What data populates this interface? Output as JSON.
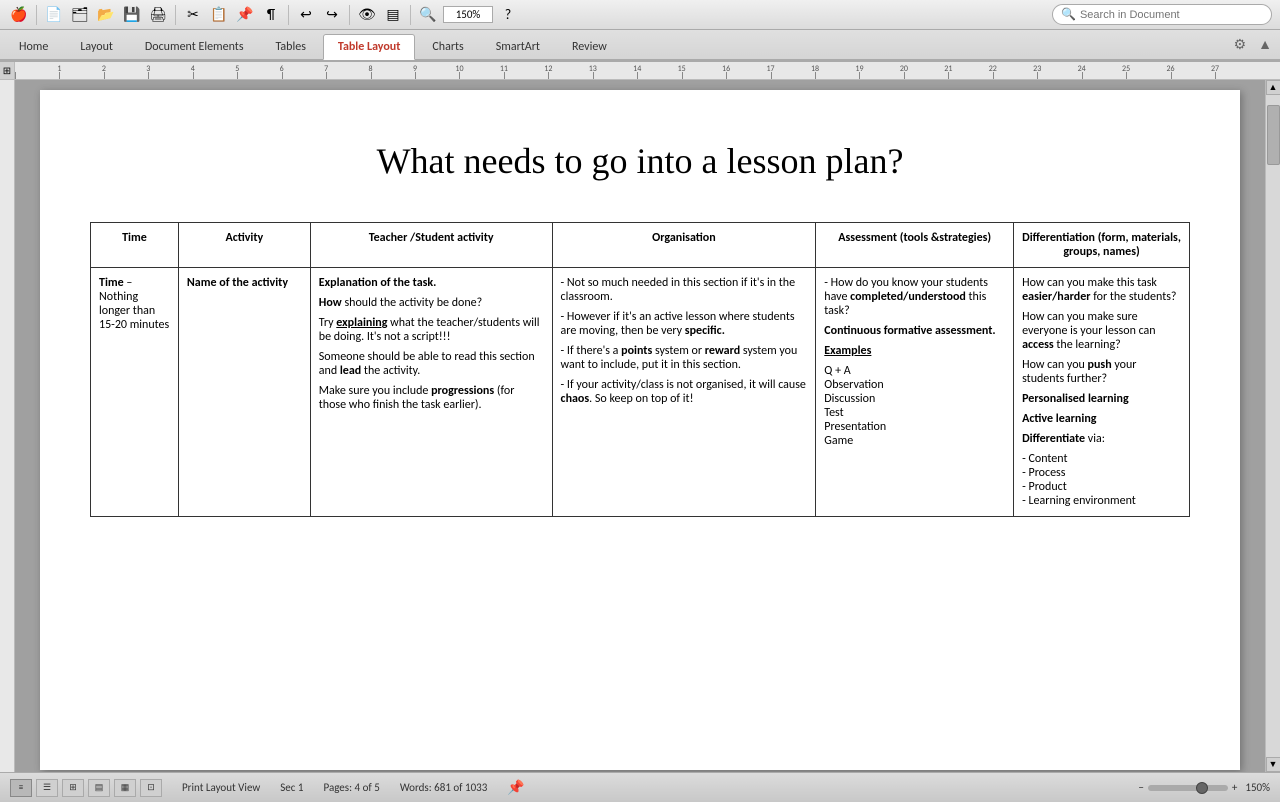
{
  "titlebar": {
    "search_placeholder": "Search in Document",
    "zoom_value": "150%"
  },
  "tabs": {
    "items": [
      "Home",
      "Layout",
      "Document Elements",
      "Tables",
      "Table Layout",
      "Charts",
      "SmartArt",
      "Review"
    ],
    "active": "Table Layout"
  },
  "document": {
    "title": "What needs to go into a lesson plan?",
    "table": {
      "headers": [
        "Time",
        "Activity",
        "Teacher /Student activity",
        "Organisation",
        "Assessment (tools &strategies)",
        "Differentiation (form, materials, groups, names)"
      ],
      "row": {
        "time": "Time – Nothing longer than 15-20 minutes",
        "activity": "Name of the activity",
        "teacher": {
          "line1": "Explanation of the task.",
          "line2_pre": "How",
          "line2_mid": " should the activity be done?",
          "line3_pre": "Try ",
          "line3_bold": "explaining",
          "line3_mid": " what the teacher/students will be doing. It's not a script!!!",
          "line4_pre": "Someone should be able to read this section and ",
          "line4_bold": "lead",
          "line4_mid": " the activity.",
          "line5_pre": "Make sure you include ",
          "line5_bold": "progressions",
          "line5_mid": " (for those who finish the task earlier)."
        },
        "organisation": {
          "line1": "- Not so much needed in this section if it's in the classroom.",
          "line2": "- However if it's an active lesson where students are moving, then be very specific.",
          "line3_pre": "- If there's a ",
          "line3_bold1": "points",
          "line3_mid": " system or ",
          "line3_bold2": "reward",
          "line3_end": " system you want to include, put it in this section.",
          "line4_pre": "- If your activity/class is not organised, it will cause ",
          "line4_bold": "chaos",
          "line4_end": ". So keep on top of it!"
        },
        "assessment": {
          "line1": "- How do you know your students have completed/understood this task?",
          "line2": "Continuous formative assessment.",
          "examples_label": "Examples",
          "examples": [
            "Q + A",
            "Observation",
            "Discussion",
            "Test",
            "Presentation",
            "Game"
          ]
        },
        "differentiation": {
          "line1_pre": "How can you make this task ",
          "line1_bold": "easier/harder",
          "line1_end": " for the students?",
          "line2_pre": "How can you make sure everyone is your lesson can ",
          "line2_bold": "access",
          "line2_end": " the learning?",
          "line3_pre": "How can you ",
          "line3_bold": "push",
          "line3_end": " your students further?",
          "personalised": "Personalised learning",
          "active": "Active learning",
          "differentiate_label": "Differentiate",
          "differentiate_via": "via:",
          "items": [
            "- Content",
            "- Process",
            "- Product",
            "- Learning environment"
          ]
        }
      }
    }
  },
  "statusbar": {
    "view": "Print Layout View",
    "section": "Sec",
    "section_num": "1",
    "pages_label": "Pages:",
    "pages_val": "4 of 5",
    "words_label": "Words:",
    "words_val": "681 of 1033",
    "zoom": "150%"
  }
}
